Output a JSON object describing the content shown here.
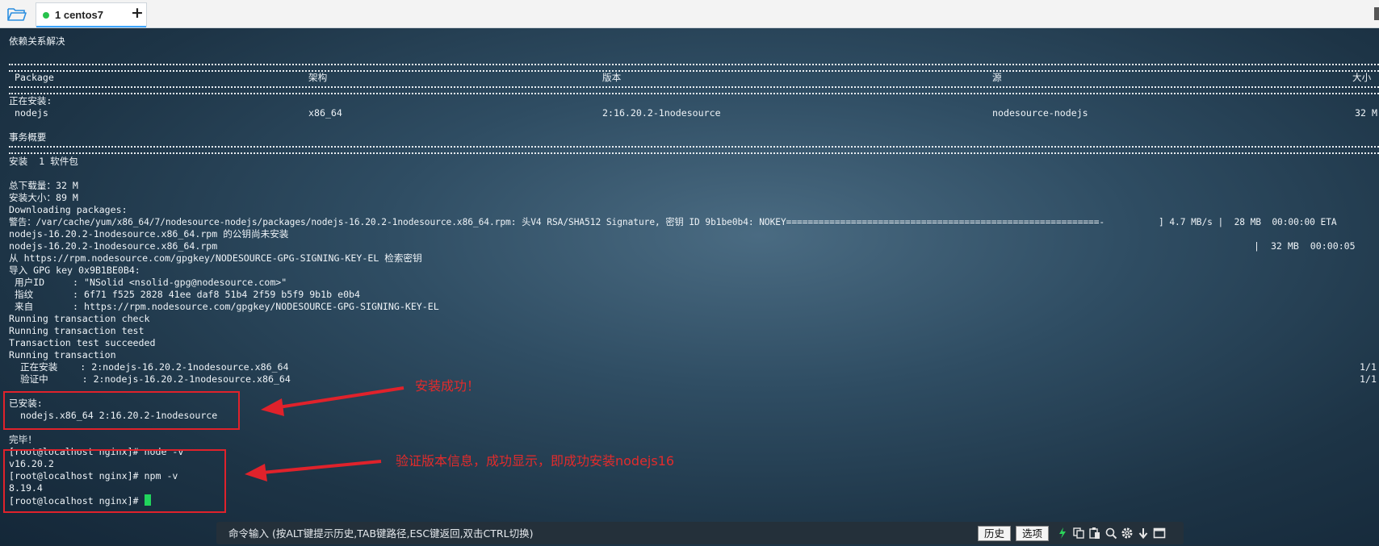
{
  "tabbar": {
    "tab_label": "1 centos7"
  },
  "terminal": {
    "line_dep": "依赖关系解决",
    "table": {
      "headers": [
        "Package",
        "架构",
        "版本",
        "源",
        "大小"
      ],
      "section_installing": "正在安装:",
      "row": [
        "nodejs",
        "x86_64",
        "2:16.20.2-1nodesource",
        "nodesource-nodejs",
        "32 M"
      ]
    },
    "summary_title": "事务概要",
    "install_count": "安装  1 软件包",
    "download_total": "总下载量：32 M",
    "install_size": "安装大小：89 M",
    "downloading": "Downloading packages:",
    "warning": "警告：/var/cache/yum/x86_64/7/nodesource-nodejs/packages/nodejs-16.20.2-1nodesource.x86_64.rpm: 头V4 RSA/SHA512 Signature, 密钥 ID 9b1be0b4: NOKEY==========================================================-          ] 4.7 MB/s |  28 MB  00:00:00 ETA",
    "pubkey_missing": "nodejs-16.20.2-1nodesource.x86_64.rpm 的公钥尚未安装",
    "rpm_file": "nodejs-16.20.2-1nodesource.x86_64.rpm",
    "rpm_stats": "|  32 MB  00:00:05",
    "retrieve_key": "从 https://rpm.nodesource.com/gpgkey/NODESOURCE-GPG-SIGNING-KEY-EL 检索密钥",
    "import_key": "导入 GPG key 0x9B1BE0B4:",
    "user_id": " 用户ID     : \"NSolid <nsolid-gpg@nodesource.com>\"",
    "fingerprint": " 指纹       : 6f71 f525 2828 41ee daf8 51b4 2f59 b5f9 9b1b e0b4",
    "from": " 来自       : https://rpm.nodesource.com/gpgkey/NODESOURCE-GPG-SIGNING-KEY-EL",
    "tx_check": "Running transaction check",
    "tx_test": "Running transaction test",
    "tx_test_ok": "Transaction test succeeded",
    "tx_run": "Running transaction",
    "installing_line": "  正在安装    : 2:nodejs-16.20.2-1nodesource.x86_64",
    "verifying_line": "  验证中      : 2:nodejs-16.20.2-1nodesource.x86_64",
    "progress_1": "1/1",
    "progress_2": "1/1",
    "installed_title": "已安装:",
    "installed_pkg": "  nodejs.x86_64 2:16.20.2-1nodesource",
    "done": "完毕！",
    "cmd_node": "[root@localhost nginx]# node -v",
    "out_node": "v16.20.2",
    "cmd_npm": "[root@localhost nginx]# npm -v",
    "out_npm": "8.19.4",
    "prompt": "[root@localhost nginx]# "
  },
  "annotations": {
    "install_success": "安装成功！",
    "verify_version": "验证版本信息，成功显示，即成功安装nodejs16"
  },
  "cmdbar": {
    "placeholder": "命令输入 (按ALT键提示历史,TAB键路径,ESC键返回,双击CTRL切换)",
    "history_label": "历史",
    "options_label": "选项"
  }
}
